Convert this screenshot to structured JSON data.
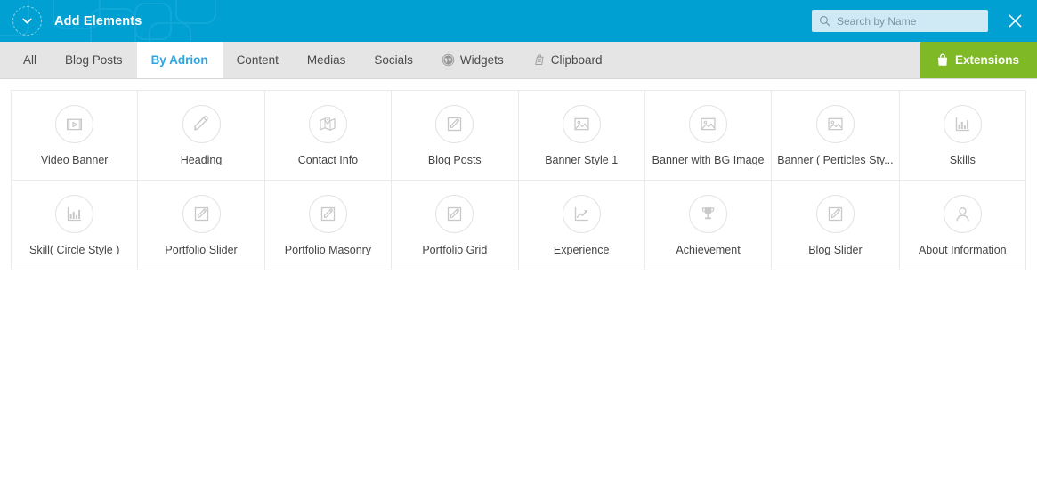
{
  "header": {
    "title": "Add Elements",
    "collapse_icon": "chevron-down-icon",
    "search": {
      "placeholder": "Search by Name",
      "value": "",
      "icon": "search-icon"
    },
    "close_icon": "close-icon",
    "accent_color": "#00a0d2"
  },
  "tabbar": {
    "tabs": [
      {
        "label": "All",
        "icon": null,
        "active": false
      },
      {
        "label": "Blog Posts",
        "icon": null,
        "active": false
      },
      {
        "label": "By Adrion",
        "icon": null,
        "active": true
      },
      {
        "label": "Content",
        "icon": null,
        "active": false
      },
      {
        "label": "Medias",
        "icon": null,
        "active": false
      },
      {
        "label": "Socials",
        "icon": null,
        "active": false
      },
      {
        "label": "Widgets",
        "icon": "wordpress-icon",
        "active": false
      },
      {
        "label": "Clipboard",
        "icon": "clipboard-icon",
        "active": false
      }
    ],
    "extensions": {
      "label": "Extensions",
      "icon": "shopping-bag-icon",
      "color": "#7fba26"
    }
  },
  "elements": [
    {
      "label": "Video Banner",
      "icon": "film-play-icon"
    },
    {
      "label": "Heading",
      "icon": "pencil-icon"
    },
    {
      "label": "Contact Info",
      "icon": "map-pin-icon"
    },
    {
      "label": "Blog Posts",
      "icon": "edit-square-icon"
    },
    {
      "label": "Banner Style 1",
      "icon": "image-icon"
    },
    {
      "label": "Banner with BG Image",
      "icon": "image-icon"
    },
    {
      "label": "Banner ( Perticles Sty...",
      "icon": "image-icon"
    },
    {
      "label": "Skills",
      "icon": "bar-chart-icon"
    },
    {
      "label": "Skill( Circle Style )",
      "icon": "bar-chart-icon"
    },
    {
      "label": "Portfolio Slider",
      "icon": "edit-square-icon"
    },
    {
      "label": "Portfolio Masonry",
      "icon": "edit-square-icon"
    },
    {
      "label": "Portfolio Grid",
      "icon": "edit-square-icon"
    },
    {
      "label": "Experience",
      "icon": "line-chart-icon"
    },
    {
      "label": "Achievement",
      "icon": "trophy-icon"
    },
    {
      "label": "Blog Slider",
      "icon": "edit-square-icon"
    },
    {
      "label": "About Information",
      "icon": "user-icon"
    }
  ]
}
